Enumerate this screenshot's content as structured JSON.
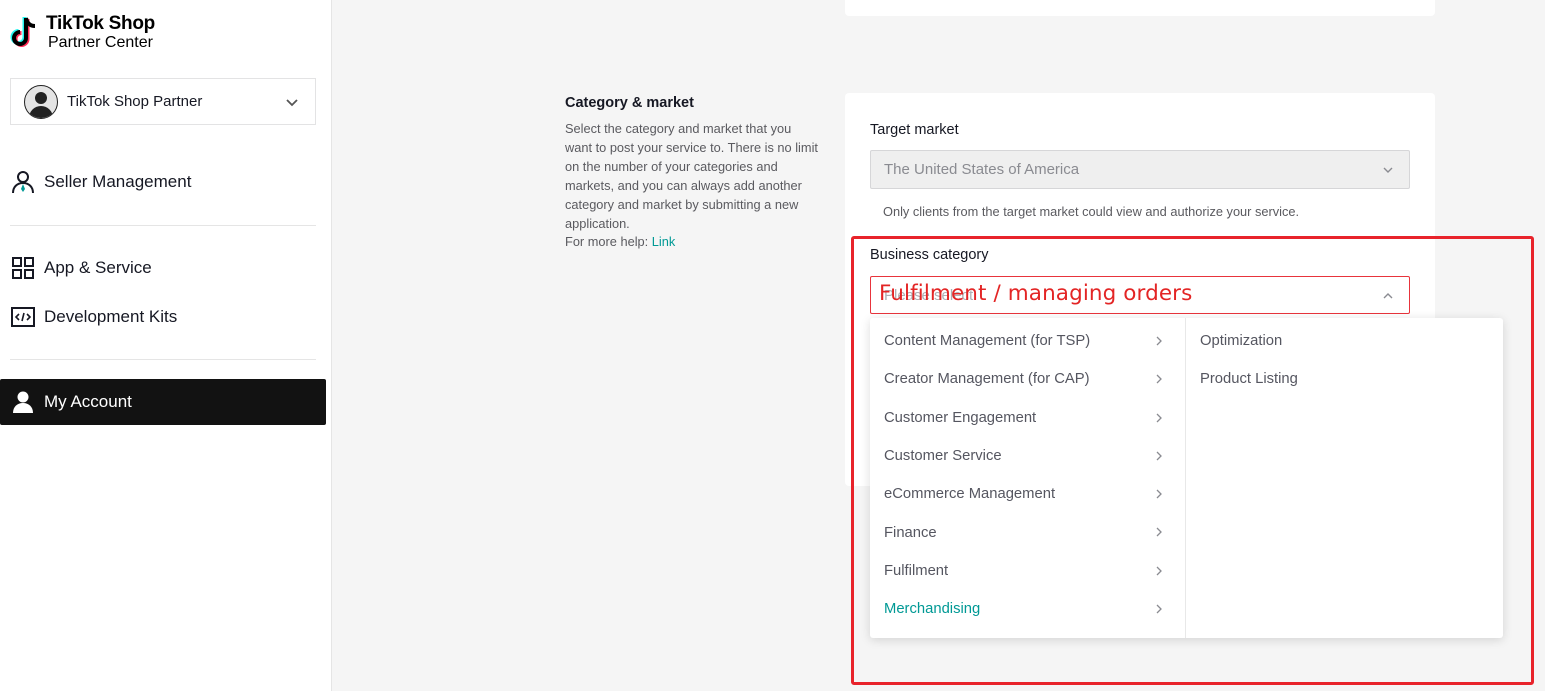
{
  "brand": {
    "line1": "TikTok Shop",
    "line2": "Partner Center"
  },
  "account": {
    "name": "TikTok Shop Partner"
  },
  "nav": {
    "seller_management": "Seller Management",
    "app_service": "App & Service",
    "development_kits": "Development Kits",
    "my_account": "My Account"
  },
  "section": {
    "title": "Category & market",
    "description": "Select the category and market that you want to post your service to. There is no limit on the number of your categories and markets, and you can always add another category and market by submitting a new application.",
    "help_prefix": "For more help: ",
    "help_link": "Link"
  },
  "form": {
    "target_market_label": "Target market",
    "target_market_value": "The United States of America",
    "target_market_hint": "Only clients from the target market could view and authorize your service.",
    "business_category_label": "Business category",
    "business_category_placeholder": "Please select"
  },
  "annotation": {
    "text": "Fulfilment / managing orders",
    "color": "#e8232b"
  },
  "dropdown": {
    "left_options": [
      "Content Management (for TSP)",
      "Creator Management (for CAP)",
      "Customer Engagement",
      "Customer Service",
      "eCommerce Management",
      "Finance",
      "Fulfilment",
      "Merchandising"
    ],
    "selected_left": "Merchandising",
    "right_options": [
      "Optimization",
      "Product Listing"
    ]
  },
  "colors": {
    "accent": "#009995",
    "active_nav_bg": "#121212",
    "error_border": "#e8343c"
  }
}
